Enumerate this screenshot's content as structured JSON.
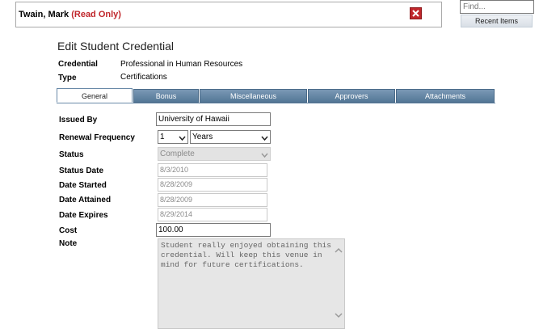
{
  "header": {
    "student_name": "Twain, Mark",
    "read_only": "(Read Only)"
  },
  "search": {
    "placeholder": "Find...",
    "recent_items_label": "Recent Items"
  },
  "page_title": "Edit Student Credential",
  "credential": {
    "label_credential": "Credential",
    "value_credential": "Professional in Human Resources",
    "label_type": "Type",
    "value_type": "Certifications"
  },
  "tabs": [
    {
      "label": "General",
      "active": true
    },
    {
      "label": "Bonus",
      "active": false
    },
    {
      "label": "Miscellaneous",
      "active": false
    },
    {
      "label": "Approvers",
      "active": false
    },
    {
      "label": "Attachments",
      "active": false
    }
  ],
  "form": {
    "issued_by": {
      "label": "Issued By",
      "value": "University of Hawaii"
    },
    "renewal_frequency": {
      "label": "Renewal Frequency",
      "number": "1",
      "unit": "Years"
    },
    "status": {
      "label": "Status",
      "value": "Complete"
    },
    "status_date": {
      "label": "Status Date",
      "value": "8/3/2010"
    },
    "date_started": {
      "label": "Date Started",
      "value": "8/28/2009"
    },
    "date_attained": {
      "label": "Date Attained",
      "value": "8/28/2009"
    },
    "date_expires": {
      "label": "Date Expires",
      "value": "8/29/2014"
    },
    "cost": {
      "label": "Cost",
      "value": "100.00"
    },
    "note": {
      "label": "Note",
      "value": "Student really enjoyed obtaining this\ncredential. Will keep this venue in\nmind for future certifications."
    }
  },
  "icons": {
    "close": "close-icon",
    "chevron": "chevron-down-icon",
    "scroll_up": "chevron-up-icon",
    "scroll_down": "chevron-down-icon"
  },
  "colors": {
    "read_only": "#c0262b",
    "tab_blue": "#5f82a2"
  }
}
